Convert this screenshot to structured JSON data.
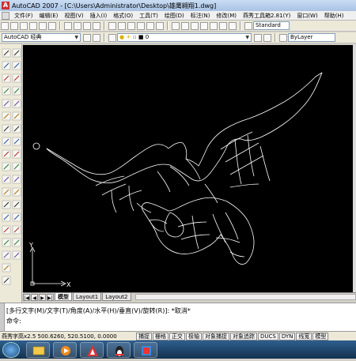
{
  "window": {
    "title": "AutoCAD 2007 - [C:\\Users\\Administrator\\Desktop\\雄鹰翱翔1.dwg]",
    "app_icon_text": "A"
  },
  "menu": [
    "文件(F)",
    "编辑(E)",
    "视图(V)",
    "插入(I)",
    "格式(O)",
    "工具(T)",
    "绘图(D)",
    "标注(N)",
    "修改(M)",
    "燕秀工具箱2.81(Y)",
    "窗口(W)",
    "帮助(H)"
  ],
  "toolbar": {
    "workspace": "AutoCAD 经典",
    "text_style": "Standard",
    "layer": "0",
    "linetype": "ByLayer"
  },
  "ucs": {
    "x_label": "X",
    "y_label": "Y"
  },
  "layout_tabs": {
    "nav": [
      "|◀",
      "◀",
      "▶",
      "▶|"
    ],
    "tabs": [
      "模型",
      "Layout1",
      "Layout2"
    ],
    "active": 0
  },
  "command": {
    "line1": "[多行文字(M)/文字(T)/角度(A)/水平(H)/垂直(V)/旋转(R)]: *取消*",
    "line2": "命令:"
  },
  "status": {
    "coords": "燕秀字高x2.5  500.6260, 520.5100, 0.0000",
    "buttons": [
      "捕捉",
      "栅格",
      "正交",
      "极轴",
      "对象捕捉",
      "对象追踪",
      "DUCS",
      "DYN",
      "线宽",
      "模型"
    ]
  },
  "colors": {
    "canvas": "#000000",
    "drawing_line": "#ffffff",
    "titlebar": "#a9c3e6"
  },
  "icons": {
    "draw_tools": [
      "line-icon",
      "construction-line-icon",
      "polyline-icon",
      "polygon-icon",
      "rectangle-icon",
      "arc-icon",
      "circle-icon",
      "revision-cloud-icon",
      "spline-icon",
      "ellipse-icon",
      "ellipse-arc-icon",
      "insert-block-icon",
      "make-block-icon",
      "point-icon",
      "hatch-icon",
      "gradient-icon",
      "region-icon",
      "table-icon",
      "multiline-text-icon"
    ],
    "modify_tools": [
      "erase-icon",
      "copy-icon",
      "mirror-icon",
      "offset-icon",
      "array-icon",
      "move-icon",
      "rotate-icon",
      "scale-icon",
      "stretch-icon",
      "trim-icon",
      "extend-icon",
      "break-point-icon",
      "break-icon",
      "join-icon",
      "chamfer-icon",
      "fillet-icon",
      "explode-icon"
    ]
  }
}
